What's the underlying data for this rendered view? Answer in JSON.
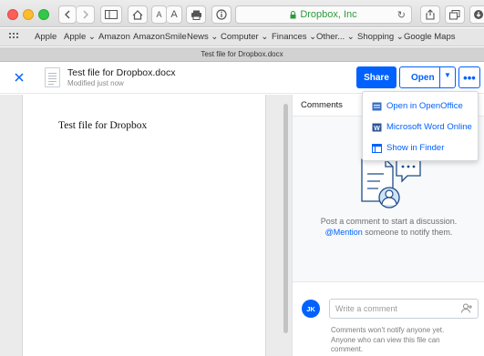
{
  "browser": {
    "address_text": "Dropbox, Inc",
    "tab_title": "Test file for Dropbox.docx",
    "font_small_label": "A",
    "font_large_label": "A"
  },
  "bookmarks": {
    "items": [
      {
        "label": "Apple"
      },
      {
        "label": "Apple ⌄"
      },
      {
        "label": "Amazon"
      },
      {
        "label": "AmazonSmile"
      },
      {
        "label": "News ⌄"
      },
      {
        "label": "Computer ⌄"
      },
      {
        "label": "Finances ⌄"
      },
      {
        "label": "Other... ⌄"
      },
      {
        "label": "Shopping ⌄"
      },
      {
        "label": "Google Maps"
      }
    ]
  },
  "header": {
    "file_name": "Test file for Dropbox.docx",
    "modified": "Modified just now",
    "share_label": "Share",
    "open_label": "Open",
    "more_label": "•••"
  },
  "open_menu": {
    "items": [
      {
        "label": "Open in OpenOffice",
        "icon": "openoffice-icon"
      },
      {
        "label": "Microsoft Word Online",
        "icon": "word-icon"
      },
      {
        "label": "Show in Finder",
        "icon": "finder-icon"
      }
    ]
  },
  "document": {
    "body_text": "Test file for Dropbox"
  },
  "comments": {
    "title": "Comments",
    "empty_line1": "Post a comment to start a discussion.",
    "mention_link": "@Mention",
    "empty_line2_rest": " someone to notify them.",
    "avatar_initials": "JK",
    "input_placeholder": "Write a comment",
    "notice_line1": "Comments won't notify anyone yet.",
    "notice_line2": "Anyone who can view this file can",
    "notice_line3": "comment."
  },
  "colors": {
    "accent": "#0061fe",
    "secure_green": "#2c9b3d"
  }
}
